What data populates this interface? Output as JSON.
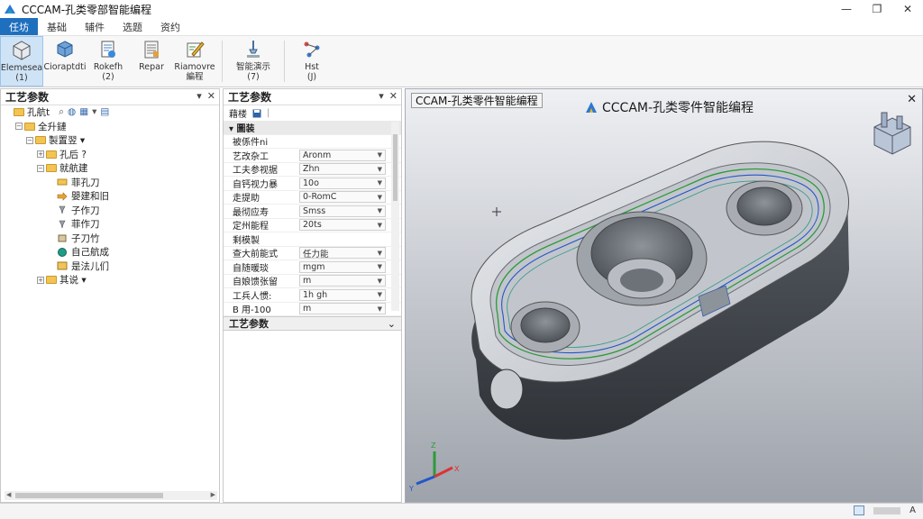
{
  "app": {
    "title": "CCCAM-孔类零部智能编程"
  },
  "window_controls": {
    "minimize": "—",
    "restore": "❐",
    "close": "✕"
  },
  "menu": {
    "tabs": [
      "任坊",
      "基础",
      "辅件",
      "选题",
      "资约"
    ]
  },
  "ribbon": {
    "buttons": [
      {
        "label1": "Elemesea",
        "label2": "(1)",
        "icon": "cube-icon"
      },
      {
        "label1": "Cioraptdti",
        "label2": "",
        "icon": "cube-blue-icon"
      },
      {
        "label1": "Rokefh",
        "label2": "(2)",
        "icon": "document-icon"
      },
      {
        "label1": "Repar",
        "label2": "",
        "icon": "report-icon"
      },
      {
        "label1": "Riamovre",
        "label2": "編程",
        "icon": "edit-icon"
      },
      {
        "label1": "智能演示",
        "label2": "(7)",
        "icon": "tool-icon"
      },
      {
        "label1": "Hst",
        "label2": "(J)",
        "icon": "flow-icon"
      }
    ]
  },
  "left_panel": {
    "title": "工艺参数",
    "pin": "▾",
    "close": "✕",
    "tree": [
      {
        "label": "孔航t",
        "indent": 0,
        "kind": "folder",
        "expander": ""
      },
      {
        "label": "全升鏈",
        "indent": 1,
        "kind": "folder",
        "expander": "−"
      },
      {
        "label": "製置翌 ▾",
        "indent": 2,
        "kind": "folder",
        "expander": "−"
      },
      {
        "label": "孔后 ?",
        "indent": 3,
        "kind": "folder",
        "expander": "+"
      },
      {
        "label": "就航建",
        "indent": 3,
        "kind": "folder",
        "expander": "−"
      },
      {
        "label": "菲孔刀",
        "indent": 4,
        "kind": "tool",
        "expander": ""
      },
      {
        "label": "嬰建和旧",
        "indent": 4,
        "kind": "arrow",
        "expander": ""
      },
      {
        "label": "子作刀",
        "indent": 4,
        "kind": "drill",
        "expander": ""
      },
      {
        "label": "菲作刀",
        "indent": 4,
        "kind": "drill",
        "expander": ""
      },
      {
        "label": "子刀竹",
        "indent": 4,
        "kind": "box",
        "expander": ""
      },
      {
        "label": "自己航成",
        "indent": 4,
        "kind": "globe",
        "expander": ""
      },
      {
        "label": "是法儿们",
        "indent": 4,
        "kind": "book",
        "expander": ""
      },
      {
        "label": "其说 ▾",
        "indent": 3,
        "kind": "folder",
        "expander": "+"
      }
    ]
  },
  "mid_panel": {
    "title": "工艺参数",
    "pin": "▾",
    "close": "✕",
    "toolbar_label": "藉楼",
    "rows": [
      {
        "type": "section",
        "label": "▾ 圖装"
      },
      {
        "type": "plain",
        "label": "被係件ni"
      },
      {
        "type": "field",
        "label": "艺改杂工",
        "value": "Aronm"
      },
      {
        "type": "field",
        "label": "工夫参视据",
        "value": "Zhn"
      },
      {
        "type": "field",
        "label": "自钙视力暴",
        "value": "10o"
      },
      {
        "type": "field",
        "label": "走提助",
        "value": "0-RomC"
      },
      {
        "type": "field",
        "label": "最彻应寿",
        "value": "Smss"
      },
      {
        "type": "field",
        "label": "定州能程",
        "value": "20ts"
      },
      {
        "type": "plain",
        "label": "剩模製"
      },
      {
        "type": "field",
        "label": "查大前能式",
        "value": "任力能"
      },
      {
        "type": "field",
        "label": "自随暖琰",
        "value": "mgm"
      },
      {
        "type": "field",
        "label": "自娘馈张留",
        "value": "m"
      },
      {
        "type": "field",
        "label": "工兵人惯:",
        "value": "1h gh"
      },
      {
        "type": "field",
        "label": "B 用-100",
        "value": "m"
      }
    ],
    "footer": "工艺参数",
    "footer_chevron": "⌄"
  },
  "viewport": {
    "label": "CCAM-孔类零件智能编程",
    "title": "CCCAM-孔类零件智能编程",
    "close": "✕",
    "axes": {
      "x": "X",
      "y": "Y",
      "z": "Z"
    }
  },
  "status": {
    "text": "A"
  },
  "colors": {
    "accent": "#1f6fbf",
    "ribbon_selected": "#cfe3f6",
    "toolpath_green": "#2e9a3a",
    "toolpath_blue": "#2456c8"
  }
}
